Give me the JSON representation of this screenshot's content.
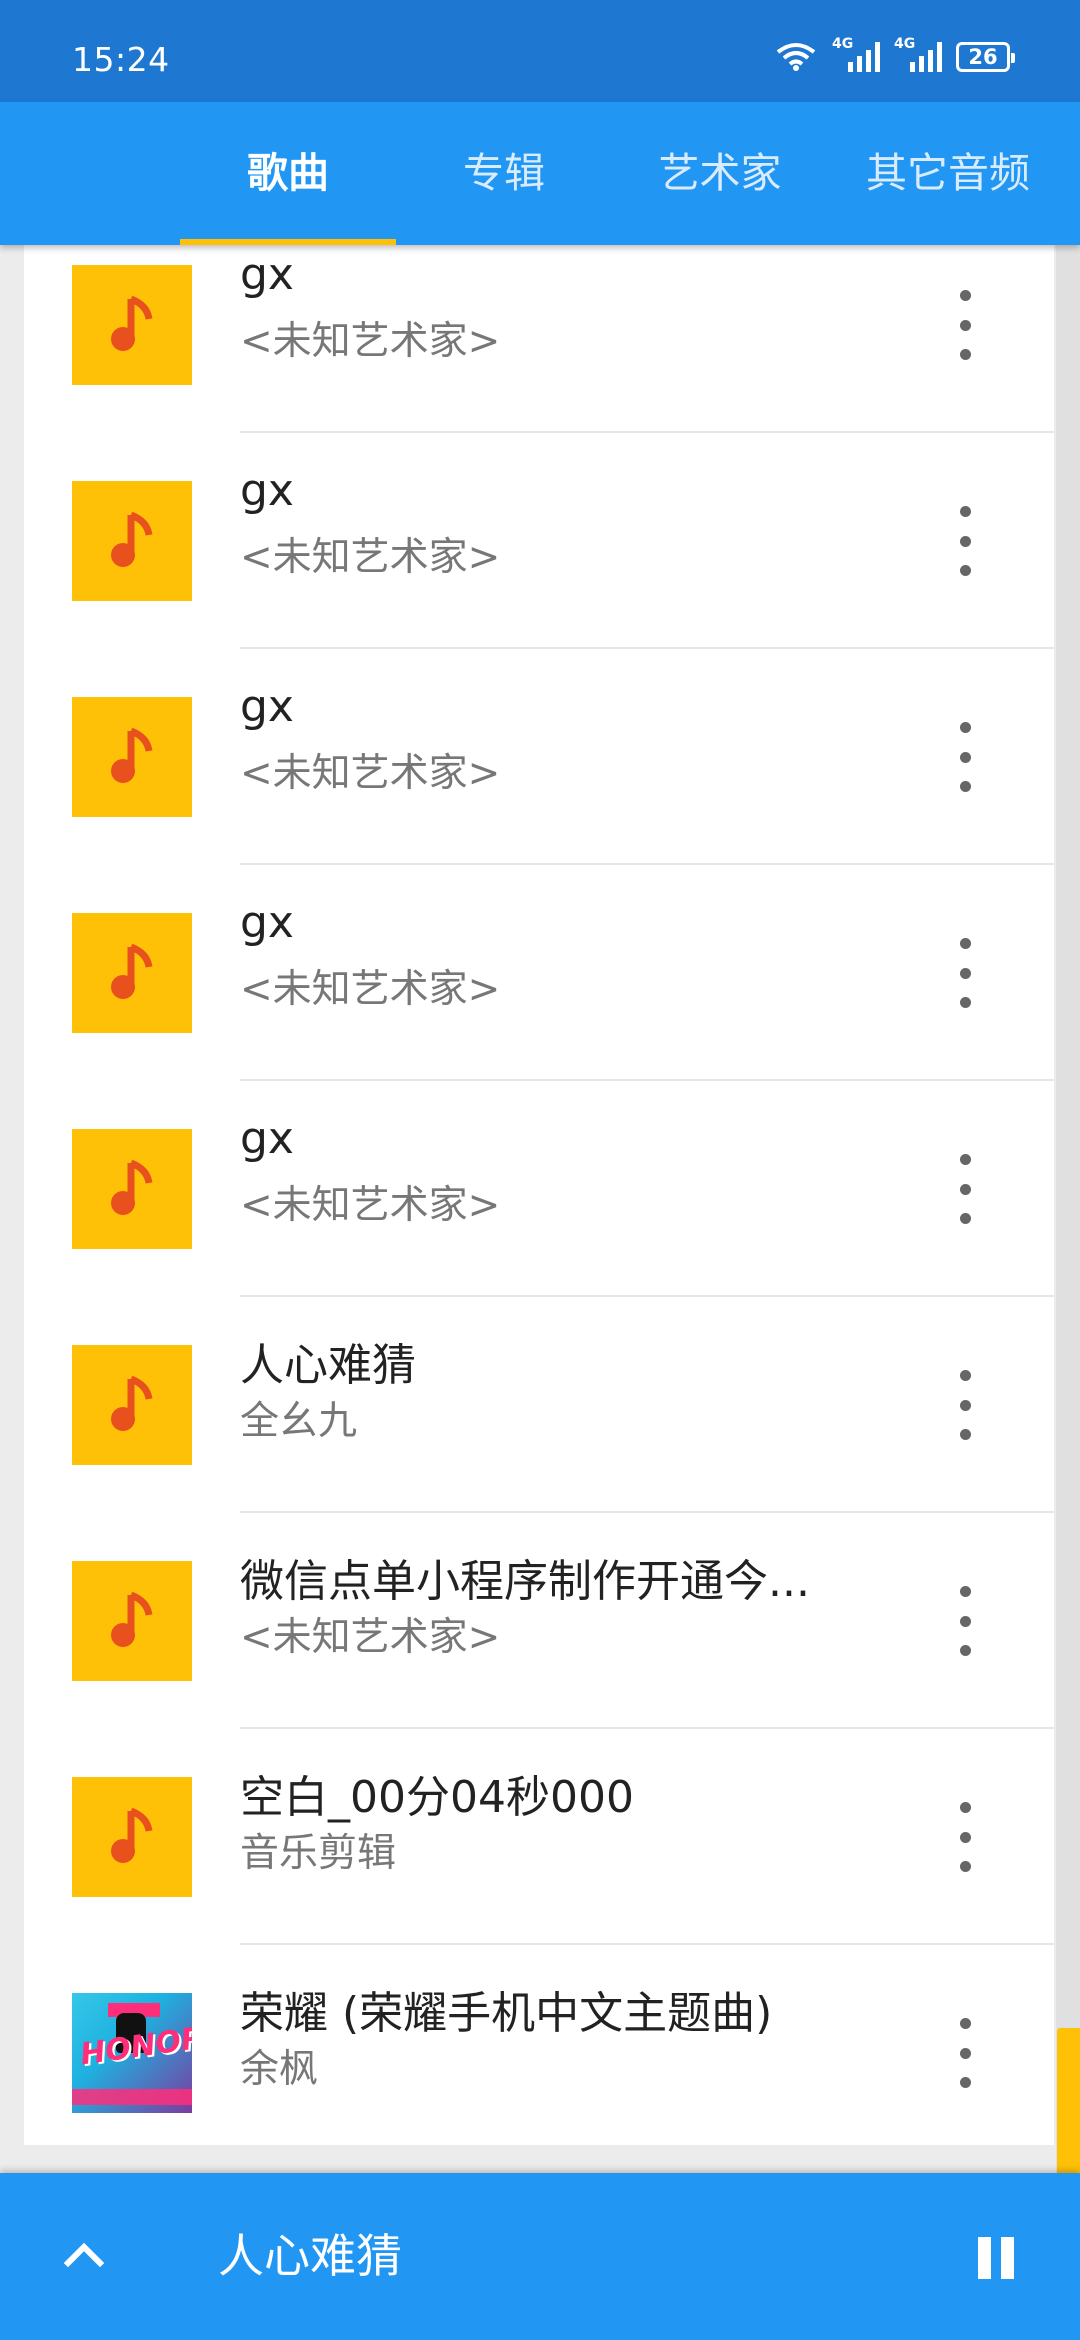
{
  "status_bar": {
    "time": "15:24",
    "network": "4G",
    "battery": "26"
  },
  "tabs": [
    {
      "label": "歌曲",
      "active": true
    },
    {
      "label": "专辑",
      "active": false
    },
    {
      "label": "艺术家",
      "active": false
    },
    {
      "label": "其它音频",
      "active": false
    }
  ],
  "songs": [
    {
      "title": "gx",
      "artist": "<未知艺术家>",
      "icon": "music-note-icon"
    },
    {
      "title": "gx",
      "artist": "<未知艺术家>",
      "icon": "music-note-icon"
    },
    {
      "title": "gx",
      "artist": "<未知艺术家>",
      "icon": "music-note-icon"
    },
    {
      "title": "gx",
      "artist": "<未知艺术家>",
      "icon": "music-note-icon"
    },
    {
      "title": "gx",
      "artist": "<未知艺术家>",
      "icon": "music-note-icon"
    },
    {
      "title": "人心难猜",
      "artist": "全幺九",
      "icon": "music-note-icon"
    },
    {
      "title": "微信点单小程序制作开通今...",
      "artist": "<未知艺术家>",
      "icon": "music-note-icon"
    },
    {
      "title": "空白_00分04秒000",
      "artist": "音乐剪辑",
      "icon": "music-note-icon"
    },
    {
      "title": "荣耀 (荣耀手机中文主题曲)",
      "artist": "余枫",
      "icon": "album-art"
    }
  ],
  "album_art_text": "HONOR",
  "now_playing": {
    "title": "人心难猜",
    "state": "playing"
  },
  "colors": {
    "primary": "#2196f3",
    "status": "#1e78d2",
    "accent": "#ffc107",
    "note": "#e8501e"
  }
}
